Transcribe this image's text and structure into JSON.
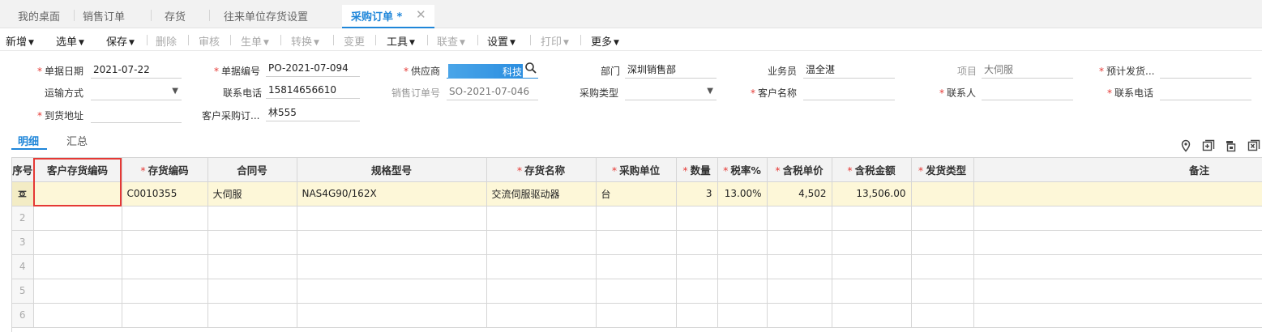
{
  "tabs": [
    {
      "label": "我的桌面"
    },
    {
      "label": "销售订单"
    },
    {
      "label": "存货"
    },
    {
      "label": "往来单位存货设置"
    },
    {
      "label": "采购订单 *"
    }
  ],
  "toolbar": {
    "new": "新增",
    "select": "选单",
    "save": "保存",
    "delete": "删除",
    "audit": "审核",
    "generate": "生单",
    "convert": "转换",
    "change": "变更",
    "tools": "工具",
    "link": "联查",
    "settings": "设置",
    "print": "打印",
    "more": "更多"
  },
  "form": {
    "doc_date_label": "单据日期",
    "doc_date": "2021-07-22",
    "doc_no_label": "单据编号",
    "doc_no": "PO-2021-07-094",
    "supplier_label": "供应商",
    "supplier_visible": "科技",
    "dept_label": "部门",
    "dept": "深圳销售部",
    "salesman_label": "业务员",
    "salesman": "温全湛",
    "project_label": "项目",
    "project": "大伺服",
    "est_ship_label": "预计发货...",
    "ship_method_label": "运输方式",
    "phone_label": "联系电话",
    "phone": "15814656610",
    "so_no_label": "销售订单号",
    "so_no": "SO-2021-07-046",
    "purchase_type_label": "采购类型",
    "customer_name_label": "客户名称",
    "contact_label": "联系人",
    "contact_phone_label": "联系电话",
    "address_label": "到货地址",
    "cust_po_label": "客户采购订...",
    "cust_po": "林555"
  },
  "subtabs": {
    "detail": "明细",
    "summary": "汇总"
  },
  "grid": {
    "headers": [
      "序号",
      "客户存货编码",
      "存货编码",
      "合同号",
      "规格型号",
      "存货名称",
      "采购单位",
      "数量",
      "税率%",
      "含税单价",
      "含税金额",
      "发货类型",
      "备注"
    ],
    "required": [
      false,
      false,
      true,
      false,
      false,
      true,
      true,
      true,
      true,
      true,
      true,
      true,
      false
    ],
    "rows": [
      {
        "idx": "",
        "cust_code": "",
        "code": "C0010355",
        "contract": "大伺服",
        "spec": "NAS4G90/162X",
        "name": "交流伺服驱动器",
        "unit": "台",
        "qty": "3",
        "tax": "13.00%",
        "price": "4,502",
        "amount": "13,506.00",
        "ship_type": "",
        "note": ""
      },
      {
        "idx": "2"
      },
      {
        "idx": "3"
      },
      {
        "idx": "4"
      },
      {
        "idx": "5"
      },
      {
        "idx": "6"
      }
    ]
  },
  "colors": {
    "accent": "#1f86d9",
    "required": "#e53935",
    "highlight_row": "#fdf7d8"
  },
  "icons": [
    "search-icon",
    "location-icon",
    "add-row-icon",
    "copy-row-icon",
    "delete-row-icon",
    "settings-gear-icon"
  ]
}
